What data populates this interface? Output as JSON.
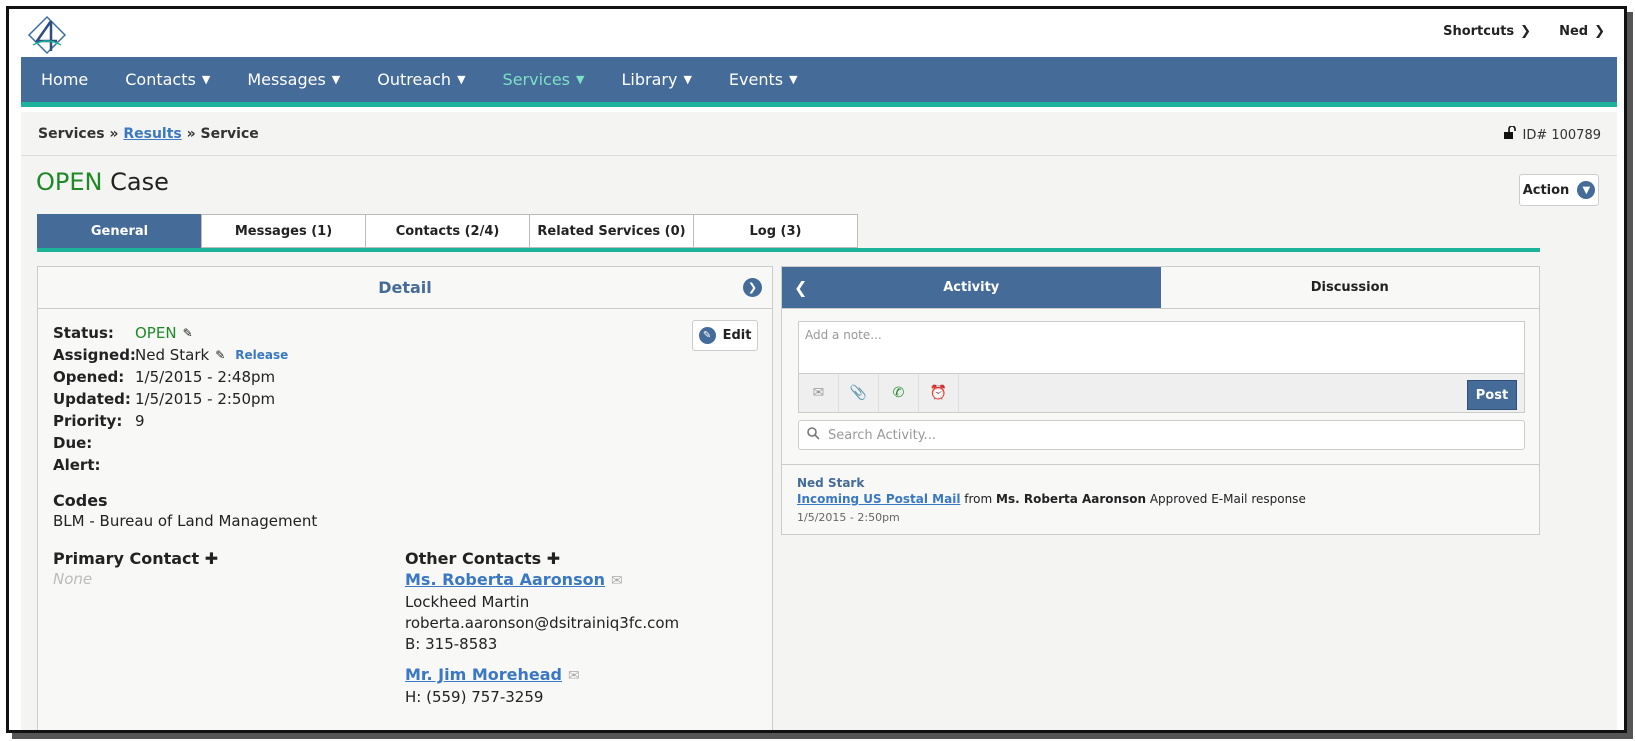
{
  "header": {
    "shortcuts_label": "Shortcuts",
    "user_label": "Ned"
  },
  "nav": {
    "items": [
      {
        "label": "Home",
        "has_menu": false
      },
      {
        "label": "Contacts",
        "has_menu": true
      },
      {
        "label": "Messages",
        "has_menu": true
      },
      {
        "label": "Outreach",
        "has_menu": true
      },
      {
        "label": "Services",
        "has_menu": true,
        "active": true
      },
      {
        "label": "Library",
        "has_menu": true
      },
      {
        "label": "Events",
        "has_menu": true
      }
    ]
  },
  "breadcrumb": {
    "root": "Services",
    "sep1": "»",
    "link": "Results",
    "sep2": "»",
    "current": "Service"
  },
  "record": {
    "id_label": "ID# 100789"
  },
  "case": {
    "status_word": "OPEN",
    "title_rest": "Case",
    "action_label": "Action"
  },
  "tabs": [
    {
      "label": "General",
      "active": true
    },
    {
      "label": "Messages (1)"
    },
    {
      "label": "Contacts (2/4)"
    },
    {
      "label": "Related Services (0)"
    },
    {
      "label": "Log (3)"
    }
  ],
  "detail": {
    "title": "Detail",
    "edit_label": "Edit",
    "fields": [
      {
        "label": "Status:",
        "value": "OPEN"
      },
      {
        "label": "Assigned:",
        "value": "Ned Stark",
        "action": "Release"
      },
      {
        "label": "Opened:",
        "value": "1/5/2015 - 2:48pm"
      },
      {
        "label": "Updated:",
        "value": "1/5/2015 - 2:50pm"
      },
      {
        "label": "Priority:",
        "value": "9"
      },
      {
        "label": "Due:",
        "value": ""
      },
      {
        "label": "Alert:",
        "value": ""
      }
    ],
    "codes_heading": "Codes",
    "codes_value": "BLM - Bureau of Land Management",
    "primary_contact_heading": "Primary Contact",
    "primary_contact_value": "None",
    "other_contacts_heading": "Other Contacts",
    "other_contacts": [
      {
        "name": "Ms. Roberta Aaronson",
        "lines": [
          "Lockheed Martin",
          "roberta.aaronson@dsitrainiq3fc.com",
          "B: 315-8583"
        ]
      },
      {
        "name": "Mr. Jim Morehead",
        "lines": [
          "H: (559) 757-3259"
        ]
      }
    ]
  },
  "activity": {
    "tab_activity": "Activity",
    "tab_discussion": "Discussion",
    "note_placeholder": "Add a note...",
    "post_label": "Post",
    "search_placeholder": "Search Activity...",
    "entry": {
      "author": "Ned Stark",
      "link_text": "Incoming US Postal Mail",
      "from_word": "from",
      "from_name": "Ms. Roberta Aaronson",
      "status_text": "Approved E-Mail response",
      "date": "1/5/2015 - 2:50pm"
    }
  },
  "colors": {
    "nav_bg": "#456b98",
    "accent": "#1db39a",
    "open_green": "#1d8a26",
    "link_blue": "#3a78c3"
  }
}
